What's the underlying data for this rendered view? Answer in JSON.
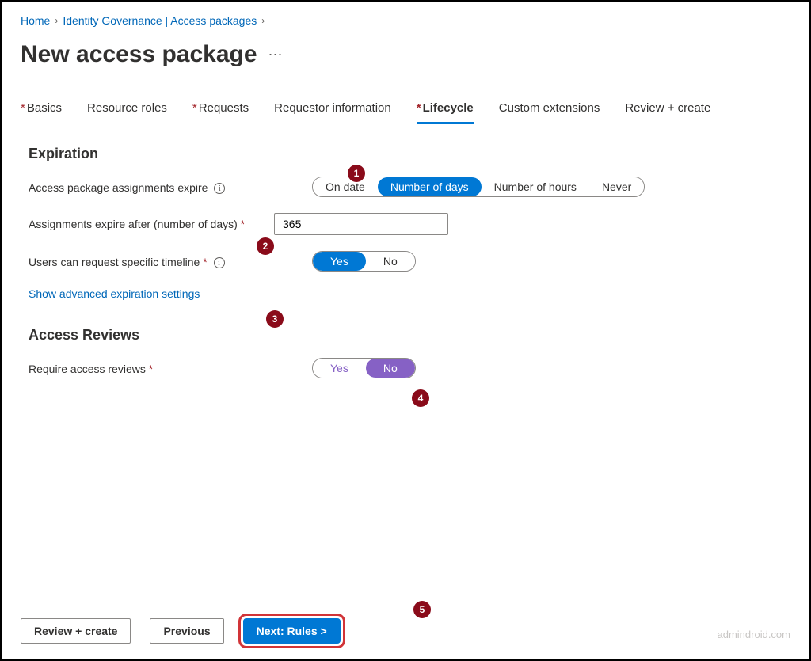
{
  "breadcrumb": {
    "home": "Home",
    "path": "Identity Governance | Access packages"
  },
  "page": {
    "title": "New access package"
  },
  "tabs": [
    {
      "label": "Basics",
      "required": true
    },
    {
      "label": "Resource roles",
      "required": false
    },
    {
      "label": "Requests",
      "required": true
    },
    {
      "label": "Requestor information",
      "required": false
    },
    {
      "label": "Lifecycle",
      "required": true,
      "active": true
    },
    {
      "label": "Custom extensions",
      "required": false
    },
    {
      "label": "Review + create",
      "required": false
    }
  ],
  "sections": {
    "expiration": {
      "title": "Expiration",
      "assignments_expire_label": "Access package assignments expire",
      "expire_options": {
        "on_date": "On date",
        "num_days": "Number of days",
        "num_hours": "Number of hours",
        "never": "Never"
      },
      "expire_after_label": "Assignments expire after (number of days)",
      "expire_after_value": "365",
      "request_timeline_label": "Users can request specific timeline",
      "yes": "Yes",
      "no": "No",
      "advanced_link": "Show advanced expiration settings"
    },
    "reviews": {
      "title": "Access Reviews",
      "require_label": "Require access reviews",
      "yes": "Yes",
      "no": "No"
    }
  },
  "callouts": {
    "c1": "1",
    "c2": "2",
    "c3": "3",
    "c4": "4",
    "c5": "5"
  },
  "footer": {
    "review_create": "Review + create",
    "previous": "Previous",
    "next": "Next: Rules >"
  },
  "watermark": "admindroid.com"
}
